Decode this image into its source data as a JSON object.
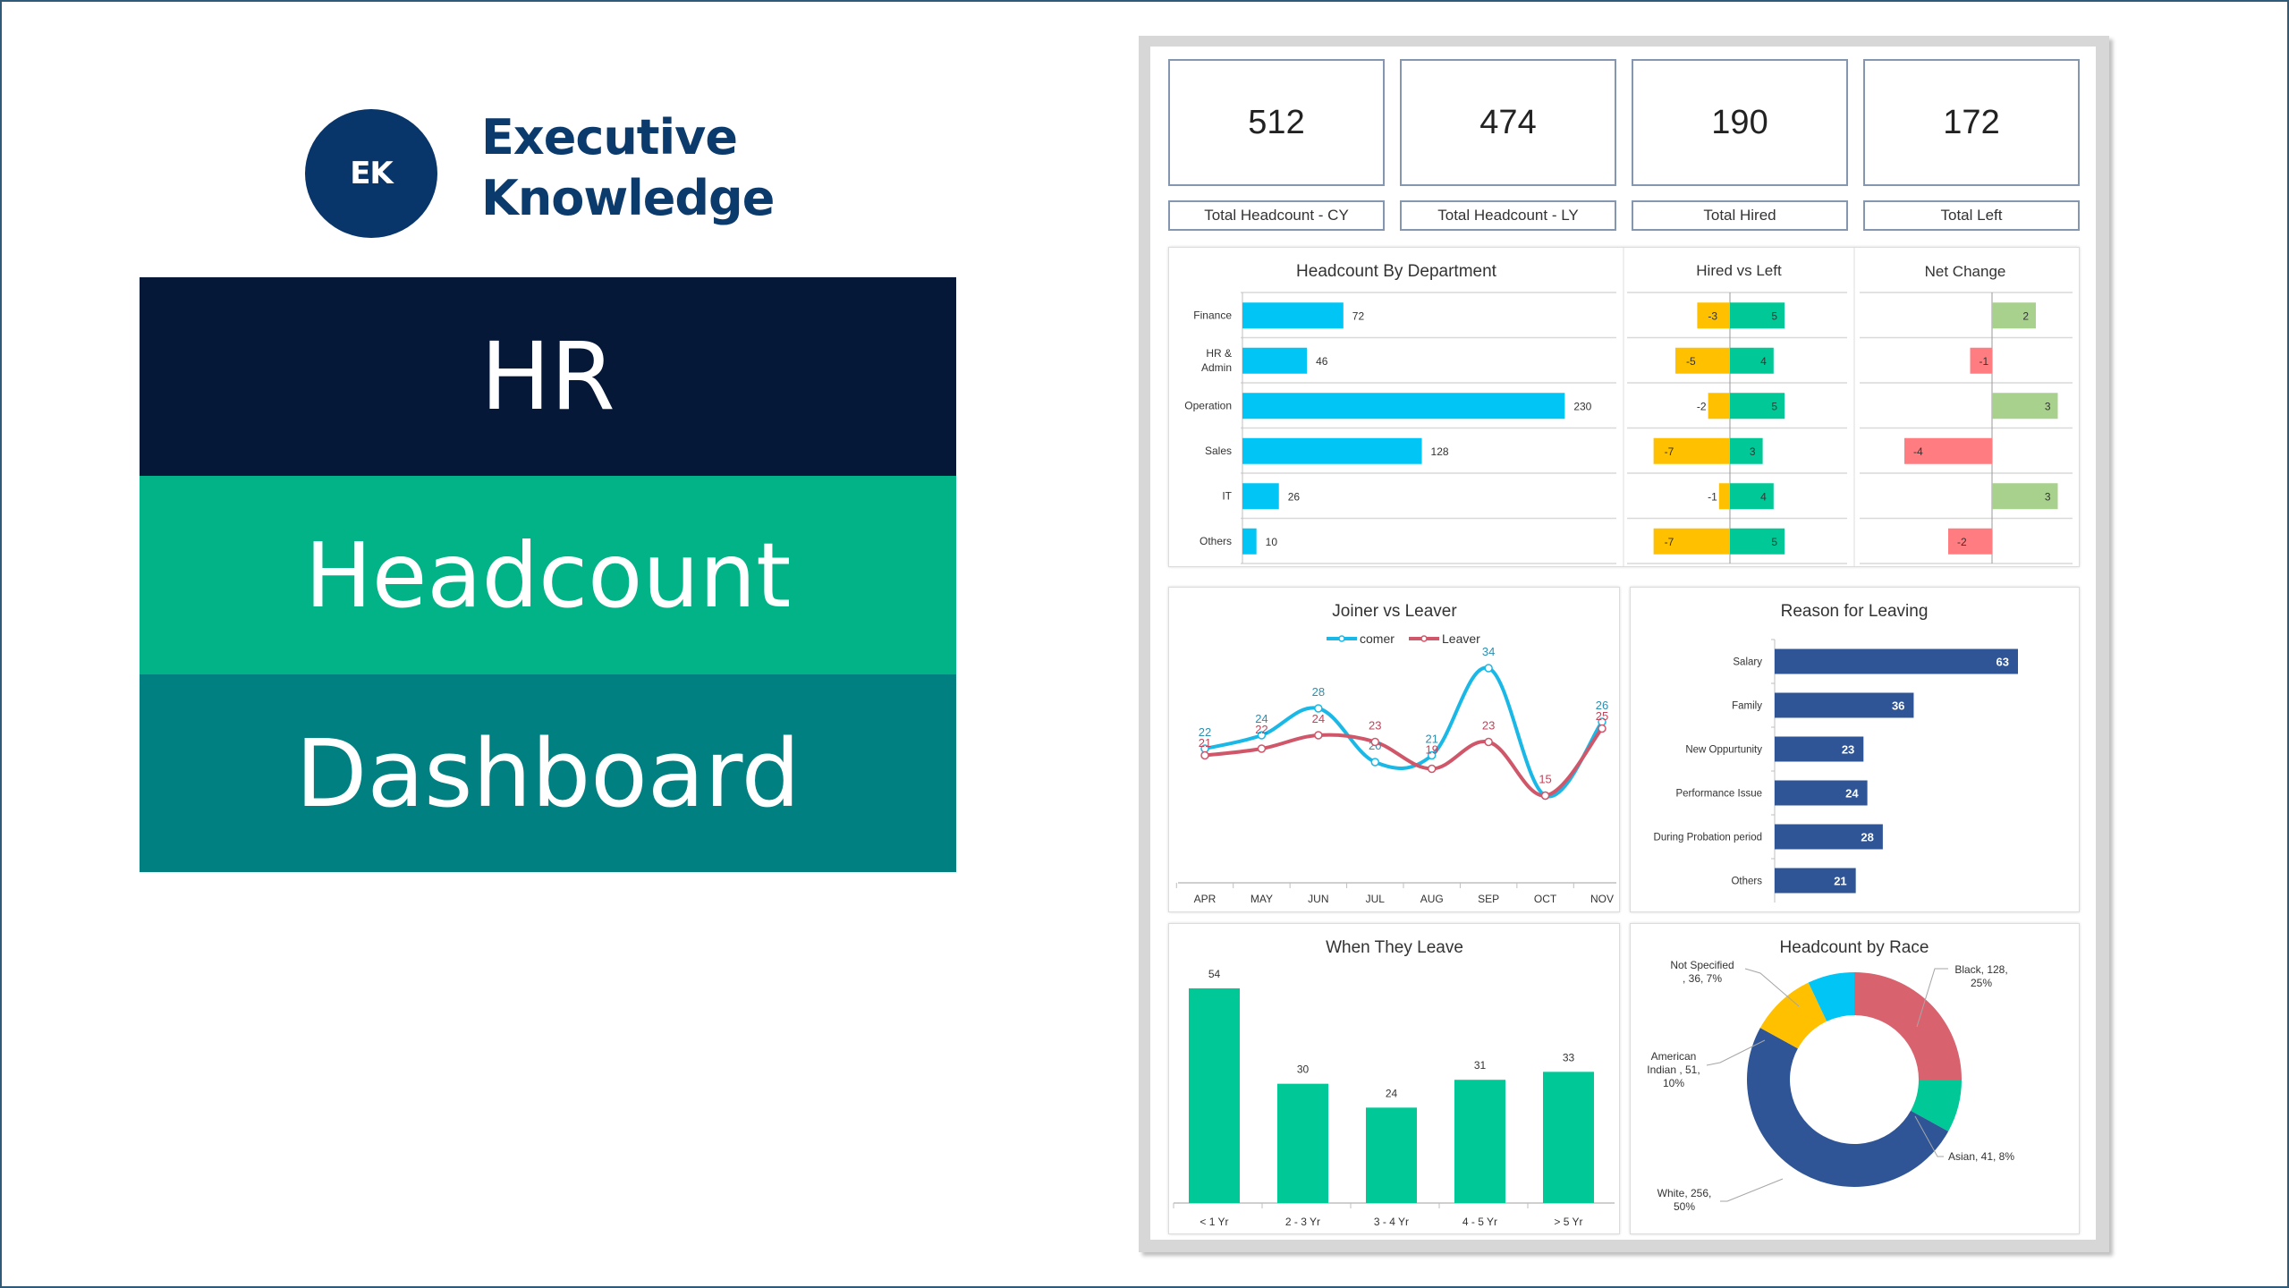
{
  "brand": {
    "logo_initials": "EK",
    "name_line1": "Executive",
    "name_line2": "Knowledge"
  },
  "title_bands": [
    "HR",
    "Headcount",
    "Dashboard"
  ],
  "colors": {
    "brand_navy": "#08356a",
    "band_dark": "#061838",
    "band_green": "#03b388",
    "band_teal": "#008080",
    "dept_bar": "#00c5f5",
    "hired": "#00c896",
    "left": "#ffc000",
    "net_positive": "#a9d18e",
    "net_negative": "#ff7c80",
    "joiner_line": "#1ab8e6",
    "leaver_line": "#d0566a",
    "reason_bar": "#2f5597",
    "tenure_bar": "#00c896"
  },
  "kpis": [
    {
      "value": "512",
      "label": "Total Headcount - CY"
    },
    {
      "value": "474",
      "label": "Total Headcount - LY"
    },
    {
      "value": "190",
      "label": "Total Hired"
    },
    {
      "value": "172",
      "label": "Total Left"
    }
  ],
  "chart_data": [
    {
      "id": "headcount-by-department",
      "type": "bar",
      "orientation": "horizontal",
      "title": "Headcount By Department",
      "categories": [
        "Finance",
        "HR & Admin",
        "Operation",
        "Sales",
        "IT",
        "Others"
      ],
      "values": [
        72,
        46,
        230,
        128,
        26,
        10
      ],
      "xlim": [
        0,
        240
      ]
    },
    {
      "id": "hired-vs-left",
      "type": "bar",
      "orientation": "horizontal",
      "title": "Hired vs Left",
      "categories": [
        "Finance",
        "HR & Admin",
        "Operation",
        "Sales",
        "IT",
        "Others"
      ],
      "series": [
        {
          "name": "Left",
          "values": [
            -3,
            -5,
            -2,
            -7,
            -1,
            -7
          ]
        },
        {
          "name": "Hired",
          "values": [
            5,
            4,
            5,
            3,
            4,
            5
          ]
        }
      ],
      "xlim": [
        -10,
        10
      ]
    },
    {
      "id": "net-change",
      "type": "bar",
      "orientation": "horizontal",
      "title": "Net Change",
      "categories": [
        "Finance",
        "HR & Admin",
        "Operation",
        "Sales",
        "IT",
        "Others"
      ],
      "values": [
        2,
        -1,
        3,
        -4,
        3,
        -2
      ],
      "xlim": [
        -6,
        4
      ]
    },
    {
      "id": "joiner-vs-leaver",
      "type": "line",
      "title": "Joiner vs Leaver",
      "categories": [
        "APR",
        "MAY",
        "JUN",
        "JUL",
        "AUG",
        "SEP",
        "OCT",
        "NOV"
      ],
      "series": [
        {
          "name": "comer",
          "values": [
            22,
            24,
            28,
            20,
            21,
            34,
            15,
            26
          ]
        },
        {
          "name": "Leaver",
          "values": [
            21,
            22,
            24,
            23,
            19,
            23,
            15,
            25
          ]
        }
      ],
      "legend": "top",
      "ylim": [
        0,
        40
      ]
    },
    {
      "id": "reason-for-leaving",
      "type": "bar",
      "orientation": "horizontal",
      "title": "Reason for Leaving",
      "categories": [
        "Salary",
        "Family",
        "New Oppurtunity",
        "Performance Issue",
        "During Probation period",
        "Others"
      ],
      "values": [
        63,
        36,
        23,
        24,
        28,
        21
      ],
      "xlim": [
        0,
        70
      ]
    },
    {
      "id": "when-they-leave",
      "type": "bar",
      "title": "When They Leave",
      "categories": [
        "< 1 Yr",
        "2 - 3 Yr",
        "3 - 4 Yr",
        "4 - 5 Yr",
        "> 5 Yr"
      ],
      "values": [
        54,
        30,
        24,
        31,
        33
      ],
      "ylim": [
        0,
        60
      ]
    },
    {
      "id": "headcount-by-race",
      "type": "pie",
      "donut": true,
      "title": "Headcount by Race",
      "slices": [
        {
          "label": "Black",
          "value": 128,
          "percent": "25%",
          "text": "Black, 128, 25%",
          "color": "#d9626f"
        },
        {
          "label": "Asian",
          "value": 41,
          "percent": "8%",
          "text": "Asian, 41, 8%",
          "color": "#00c896"
        },
        {
          "label": "White",
          "value": 256,
          "percent": "50%",
          "text": "White, 256, 50%",
          "color": "#2f5597"
        },
        {
          "label": "American Indian",
          "value": 51,
          "percent": "10%",
          "text": "American Indian , 51, 10%",
          "color": "#ffc000"
        },
        {
          "label": "Not Specified",
          "value": 36,
          "percent": "7%",
          "text": "Not Specified , 36, 7%",
          "color": "#00c5f5"
        }
      ]
    }
  ]
}
